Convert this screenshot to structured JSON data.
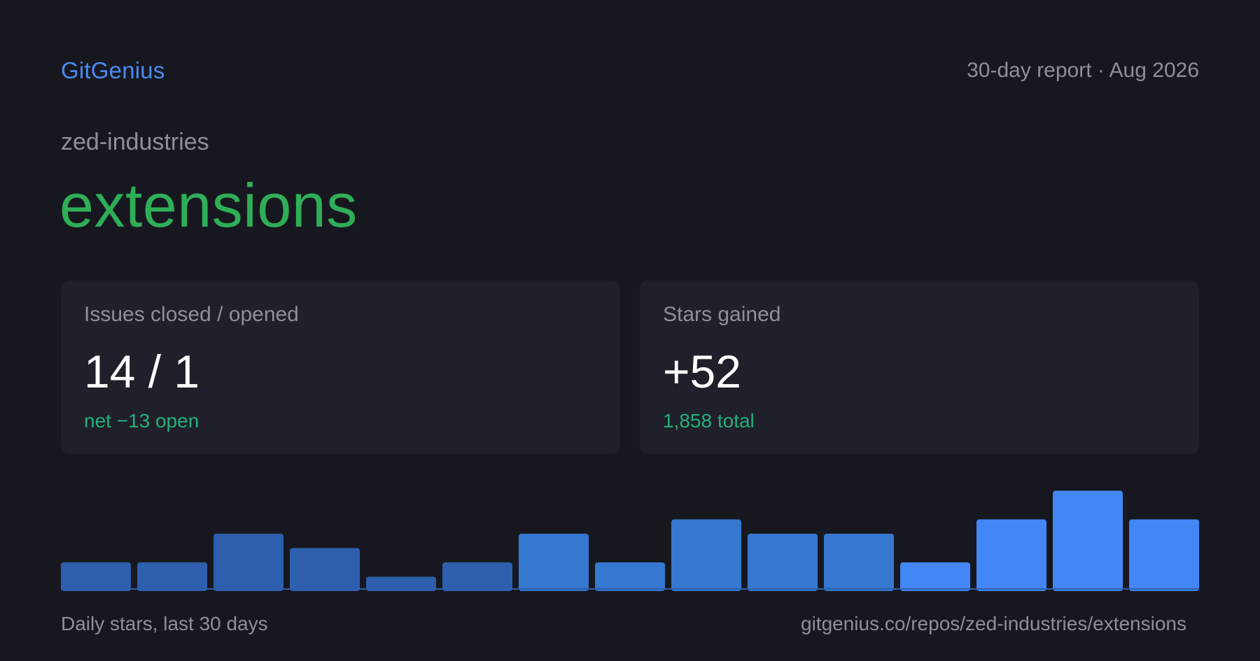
{
  "header": {
    "brand": "GitGenius",
    "report": "30-day report · Aug 2026"
  },
  "repo": {
    "owner": "zed-industries",
    "name": "extensions"
  },
  "cards": {
    "issues": {
      "label": "Issues closed / opened",
      "value": "14 / 1",
      "sub": "net −13 open"
    },
    "stars": {
      "label": "Stars gained",
      "value": "+52",
      "sub": "1,858 total"
    }
  },
  "footer": {
    "caption": "Daily stars, last 30 days",
    "url": "gitgenius.co/repos/zed-industries/extensions"
  },
  "colors": {
    "background": "#17181f",
    "brand": "#4a8bf0",
    "repo_name": "#2fae58",
    "accent_green": "#22b07d",
    "bar_dark": "#2e5fae",
    "bar_mid": "#3578d0",
    "bar_bright": "#4287f5"
  },
  "chart_data": {
    "type": "bar",
    "values": [
      2,
      2,
      4,
      3,
      1,
      2,
      4,
      2,
      5,
      4,
      4,
      2,
      5,
      7,
      5
    ],
    "ylim": [
      0,
      8
    ],
    "grid": false,
    "legend": "none"
  }
}
